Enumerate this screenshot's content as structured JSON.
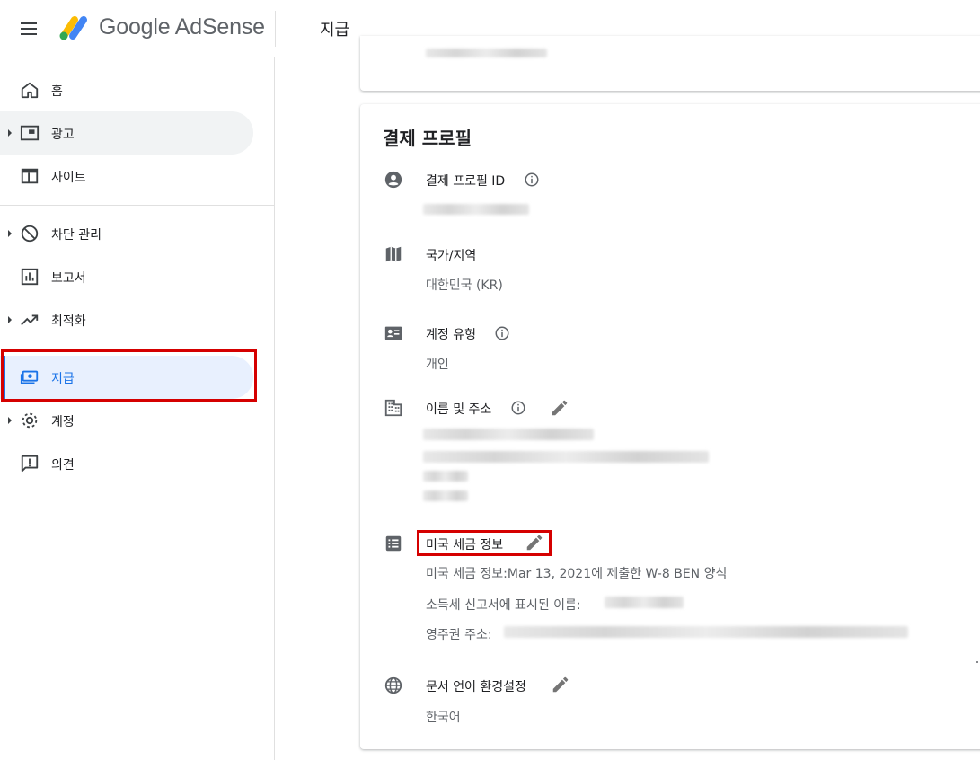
{
  "header": {
    "app_name": "Google AdSense",
    "page_title": "지급"
  },
  "sidebar": {
    "items": [
      {
        "label": "홈",
        "icon": "home-icon",
        "expandable": false,
        "state": "normal"
      },
      {
        "label": "광고",
        "icon": "ads-icon",
        "expandable": true,
        "state": "hover"
      },
      {
        "label": "사이트",
        "icon": "sites-icon",
        "expandable": false,
        "state": "normal"
      },
      {
        "label": "차단 관리",
        "icon": "block-icon",
        "expandable": true,
        "state": "normal"
      },
      {
        "label": "보고서",
        "icon": "reports-icon",
        "expandable": false,
        "state": "normal"
      },
      {
        "label": "최적화",
        "icon": "trending-up-icon",
        "expandable": true,
        "state": "normal"
      },
      {
        "label": "지급",
        "icon": "payments-icon",
        "expandable": false,
        "state": "active",
        "highlighted": true
      },
      {
        "label": "계정",
        "icon": "gear-icon",
        "expandable": true,
        "state": "normal"
      },
      {
        "label": "의견",
        "icon": "feedback-icon",
        "expandable": false,
        "state": "normal"
      }
    ]
  },
  "profile": {
    "title": "결제 프로필",
    "payment_profile_id": {
      "label": "결제 프로필 ID",
      "value_redacted": true
    },
    "country": {
      "label": "국가/지역",
      "value": "대한민국 (KR)"
    },
    "account_type": {
      "label": "계정 유형",
      "value": "개인"
    },
    "name_address": {
      "label": "이름 및 주소",
      "value_redacted": true
    },
    "us_tax": {
      "label": "미국 세금 정보",
      "highlighted": true,
      "line1": "미국 세금 정보:Mar 13, 2021에 제출한 W-8 BEN 양식",
      "line2_label": "소득세 신고서에 표시된 이름:",
      "line3_label": "영주권 주소:"
    },
    "document_language": {
      "label": "문서 언어 환경설정",
      "value": "한국어"
    }
  },
  "colors": {
    "accent": "#1a73e8",
    "active_bg": "#e8f0fe",
    "hover_bg": "#f1f3f4",
    "highlight_box": "#d50000",
    "text_primary": "#202124",
    "text_secondary": "#5f6368",
    "logo_yellow": "#fbbc04",
    "logo_green": "#34a853",
    "logo_blue": "#4285f4"
  }
}
